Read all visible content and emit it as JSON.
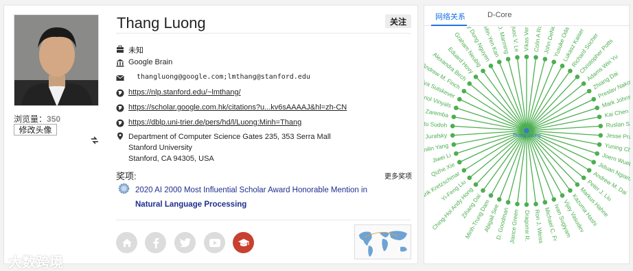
{
  "profile": {
    "name": "Thang Luong",
    "follow_label": "关注",
    "views_label": "浏览量：",
    "views_count": "350",
    "edit_avatar_label": "修改头像",
    "title": "未知",
    "org": "Google Brain",
    "email": "thangluong@google.com;lmthang@stanford.edu",
    "homepage": "https://nlp.stanford.edu/~lmthang/",
    "scholar": "https://scholar.google.com.hk/citations?u...kv6sAAAAJ&hl=zh-CN",
    "dblp": "https://dblp.uni-trier.de/pers/hd/l/Luong:Minh=Thang",
    "address_line1": "Department of Computer Science Gates 235, 353 Serra Mall",
    "address_line2": "Stanford University",
    "address_line3": "Stanford, CA 94305, USA"
  },
  "awards": {
    "label": "奖项:",
    "more_label": "更多奖项",
    "items": [
      {
        "line1": "2020 AI 2000 Most Influential Scholar Award Honorable Mention in",
        "line2": "Natural Language Processing"
      }
    ]
  },
  "social": {
    "icons": [
      "home-icon",
      "facebook-icon",
      "twitter-icon",
      "youtube-icon",
      "graduation-cap-icon"
    ]
  },
  "watermark": "大数跨境",
  "network": {
    "tabs": [
      "网络关系",
      "D-Core"
    ],
    "active_tab": 0,
    "center_label": "Thang Luong",
    "color": "#4caf50",
    "center_color": "#3a78c9",
    "nodes": [
      "Vikas Verma",
      "Colin A Raff",
      "John DeNero",
      "Yusuke Oda",
      "Lukasz Kaiser",
      "Richard Socher",
      "Christopher Potts",
      "Adams Wei Yu",
      "Zhiang Dai",
      "Preslav Nakov",
      "Mark Johnson",
      "Kai Chen",
      "Ruslan Sala",
      "Jesse Prab",
      "Yuning Chai",
      "Joern Wuebk",
      "Jiduan Ngiam",
      "Andrew M. Dai",
      "Peter J. Liu",
      "Markus Hahne",
      "Kazuma Hashi",
      "Vijay Vasudev",
      "Ivan Sugiyam",
      "Michael C. Fr",
      "Ron J. Weiss",
      "Dragomir R.",
      "Jiance Green",
      "D. Goodman",
      "Abigail See",
      "Minh-Trung Dam",
      "Zihang Dai",
      "Ching-Hoi Andy Hong",
      "Yi-Feng Liu",
      "Hendrik Kretzschmar",
      "Qizhe Xie",
      "Jiwei Li",
      "Zhilin Yang",
      "Dan Jurafsky",
      "Ruhito Sudoh",
      "Nick Zaremba",
      "Oriol Vinyals",
      "Ilya Sutskever",
      "Andrew M. Finch",
      "Alexandra Birch",
      "Eduard Hovy",
      "Graham Neubig",
      "Huy Dung Nguyen",
      "Min-Yen Kan",
      "Christopher D. Manning",
      "Quoc V. Le"
    ]
  }
}
